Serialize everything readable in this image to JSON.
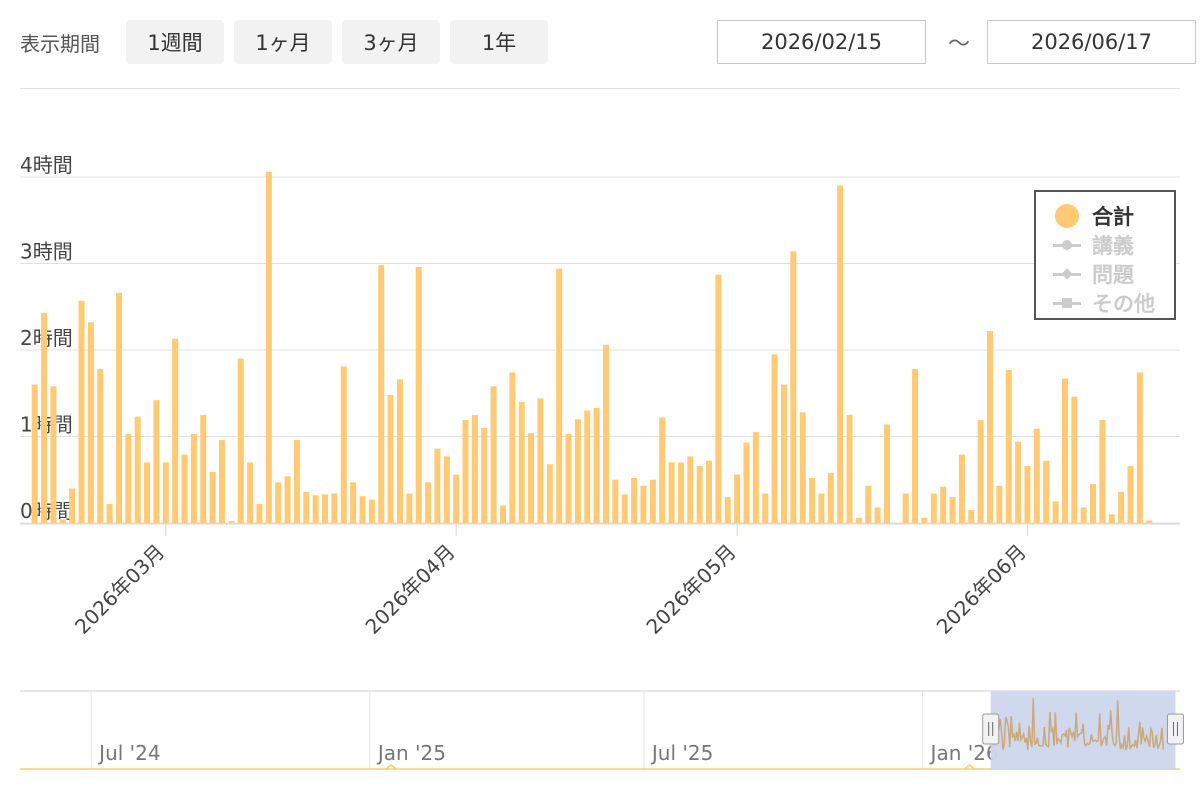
{
  "toolbar": {
    "period_label": "表示期間",
    "buttons": [
      "1週間",
      "1ヶ月",
      "3ヶ月",
      "1年"
    ],
    "date_from": "2026/02/15",
    "separator": "〜",
    "date_to": "2026/06/17"
  },
  "colors": {
    "bar": "#ffca73",
    "grid": "#e0e0e0",
    "legend_inactive": "#cccccc",
    "navigator_mask": "#ccd6eb"
  },
  "legend": {
    "items": [
      {
        "label": "合計",
        "active": true,
        "symbol": "circle"
      },
      {
        "label": "講義",
        "active": false,
        "symbol": "circle"
      },
      {
        "label": "問題",
        "active": false,
        "symbol": "diamond"
      },
      {
        "label": "その他",
        "active": false,
        "symbol": "square"
      }
    ]
  },
  "chart_data": {
    "type": "bar",
    "unit": "hours",
    "x": [
      "2026-02-15",
      "2026-02-16",
      "2026-02-17",
      "2026-02-18",
      "2026-02-19",
      "2026-02-20",
      "2026-02-21",
      "2026-02-22",
      "2026-02-23",
      "2026-02-24",
      "2026-02-25",
      "2026-02-26",
      "2026-02-27",
      "2026-02-28",
      "2026-03-01",
      "2026-03-02",
      "2026-03-03",
      "2026-03-04",
      "2026-03-05",
      "2026-03-06",
      "2026-03-07",
      "2026-03-08",
      "2026-03-09",
      "2026-03-10",
      "2026-03-11",
      "2026-03-12",
      "2026-03-13",
      "2026-03-14",
      "2026-03-15",
      "2026-03-16",
      "2026-03-17",
      "2026-03-18",
      "2026-03-19",
      "2026-03-20",
      "2026-03-21",
      "2026-03-22",
      "2026-03-23",
      "2026-03-24",
      "2026-03-25",
      "2026-03-26",
      "2026-03-27",
      "2026-03-28",
      "2026-03-29",
      "2026-03-30",
      "2026-03-31",
      "2026-04-01",
      "2026-04-02",
      "2026-04-03",
      "2026-04-04",
      "2026-04-05",
      "2026-04-06",
      "2026-04-07",
      "2026-04-08",
      "2026-04-09",
      "2026-04-10",
      "2026-04-11",
      "2026-04-12",
      "2026-04-13",
      "2026-04-14",
      "2026-04-15",
      "2026-04-16",
      "2026-04-17",
      "2026-04-18",
      "2026-04-19",
      "2026-04-20",
      "2026-04-21",
      "2026-04-22",
      "2026-04-23",
      "2026-04-24",
      "2026-04-25",
      "2026-04-26",
      "2026-04-27",
      "2026-04-28",
      "2026-04-29",
      "2026-04-30",
      "2026-05-01",
      "2026-05-02",
      "2026-05-03",
      "2026-05-04",
      "2026-05-05",
      "2026-05-06",
      "2026-05-07",
      "2026-05-08",
      "2026-05-09",
      "2026-05-10",
      "2026-05-11",
      "2026-05-12",
      "2026-05-13",
      "2026-05-14",
      "2026-05-15",
      "2026-05-16",
      "2026-05-17",
      "2026-05-18",
      "2026-05-19",
      "2026-05-20",
      "2026-05-21",
      "2026-05-22",
      "2026-05-23",
      "2026-05-24",
      "2026-05-25",
      "2026-05-26",
      "2026-05-27",
      "2026-05-28",
      "2026-05-29",
      "2026-05-30",
      "2026-05-31",
      "2026-06-01",
      "2026-06-02",
      "2026-06-03",
      "2026-06-04",
      "2026-06-05",
      "2026-06-06",
      "2026-06-07",
      "2026-06-08",
      "2026-06-09",
      "2026-06-10",
      "2026-06-11",
      "2026-06-12",
      "2026-06-13",
      "2026-06-14",
      "2026-06-15",
      "2026-06-16",
      "2026-06-17"
    ],
    "series": [
      {
        "name": "合計",
        "values": [
          1.6,
          2.43,
          1.58,
          0.04,
          0.4,
          2.57,
          2.32,
          1.78,
          0.22,
          2.66,
          1.03,
          1.23,
          0.7,
          1.42,
          0.7,
          2.13,
          0.79,
          1.03,
          1.25,
          0.59,
          0.96,
          0.02,
          1.9,
          0.7,
          0.22,
          4.06,
          0.47,
          0.54,
          0.96,
          0.36,
          0.32,
          0.33,
          0.34,
          1.81,
          0.47,
          0.31,
          0.27,
          2.98,
          1.48,
          1.66,
          0.34,
          2.96,
          0.47,
          0.86,
          0.77,
          0.56,
          1.19,
          1.25,
          1.1,
          1.58,
          0.2,
          1.74,
          1.4,
          1.04,
          1.44,
          0.68,
          2.94,
          1.03,
          1.2,
          1.3,
          1.33,
          2.06,
          0.5,
          0.33,
          0.52,
          0.43,
          0.5,
          1.22,
          0.7,
          0.7,
          0.77,
          0.66,
          0.72,
          2.87,
          0.3,
          0.56,
          0.93,
          1.05,
          0.34,
          1.95,
          1.6,
          3.14,
          1.28,
          0.52,
          0.34,
          0.58,
          3.9,
          1.25,
          0.06,
          0.43,
          0.18,
          1.14,
          0,
          0.34,
          1.78,
          0.06,
          0.34,
          0.42,
          0.3,
          0.79,
          0.15,
          1.19,
          2.22,
          0.43,
          1.77,
          0.94,
          0.66,
          1.09,
          0.72,
          0.25,
          1.67,
          1.46,
          0.18,
          0.45,
          1.19,
          0.1,
          0.36,
          0.66,
          1.74,
          0.03
        ]
      }
    ],
    "ylim": [
      0,
      4
    ],
    "yticks": [
      "0時間",
      "1時間",
      "2時間",
      "3時間",
      "4時間"
    ],
    "xticks": [
      {
        "date": "2026-03-01",
        "label": "2026年03月"
      },
      {
        "date": "2026-04-01",
        "label": "2026年04月"
      },
      {
        "date": "2026-05-01",
        "label": "2026年05月"
      },
      {
        "date": "2026-06-01",
        "label": "2026年06月"
      }
    ],
    "grid": true,
    "legend_position": "top-right",
    "navigator": {
      "labels": [
        "Jul '24",
        "Jan '25",
        "Jul '25",
        "Jan '26"
      ],
      "range": [
        "2024-05-15",
        "2026-06-20"
      ],
      "selected": [
        "2026-02-15",
        "2026-06-17"
      ]
    }
  }
}
